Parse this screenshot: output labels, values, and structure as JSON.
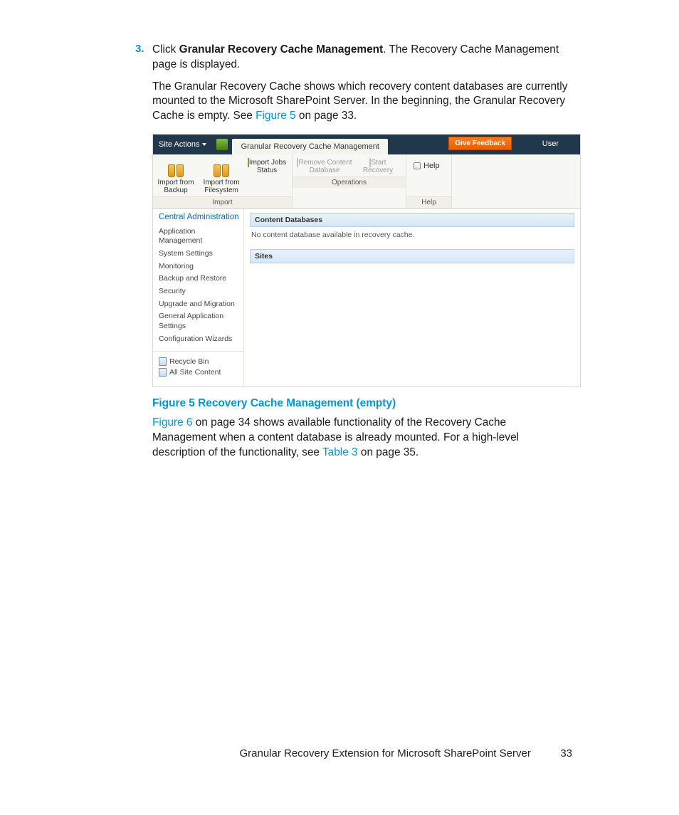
{
  "list": {
    "num": "3."
  },
  "para1": {
    "pre": "Click ",
    "bold": "Granular Recovery Cache Management",
    "post": ". The Recovery Cache Management page is displayed."
  },
  "para2": {
    "pre": "The Granular Recovery Cache shows which recovery content databases are currently mounted to the Microsoft SharePoint Server. In the beginning, the Granular Recovery Cache is empty. See ",
    "link": "Figure 5",
    "post": " on page 33."
  },
  "screenshot": {
    "topbar": {
      "site_actions": "Site Actions",
      "tab": "Granular Recovery Cache Management",
      "feedback": "Give Feedback",
      "user": "User"
    },
    "ribbon": {
      "groups": {
        "import": {
          "label": "Import",
          "btns": [
            {
              "l1": "Import from",
              "l2": "Backup"
            },
            {
              "l1": "Import from",
              "l2": "Filesystem"
            },
            {
              "l1": "Import Jobs",
              "l2": "Status"
            }
          ]
        },
        "operations": {
          "label": "Operations",
          "btns": [
            {
              "l1": "Remove Content",
              "l2": "Database"
            },
            {
              "l1": "Start",
              "l2": "Recovery"
            }
          ]
        },
        "help": {
          "label": "Help",
          "btn": "Help"
        }
      }
    },
    "sidebar": {
      "heading": "Central Administration",
      "items": [
        "Application Management",
        "System Settings",
        "Monitoring",
        "Backup and Restore",
        "Security",
        "Upgrade and Migration",
        "General Application Settings",
        "Configuration Wizards"
      ],
      "extras": [
        "Recycle Bin",
        "All Site Content"
      ]
    },
    "main": {
      "section1_title": "Content Databases",
      "section1_msg": "No content database available in recovery cache.",
      "section2_title": "Sites"
    }
  },
  "figure_caption": "Figure 5 Recovery Cache Management (empty)",
  "para3": {
    "link1": "Figure 6",
    "mid1": " on page 34 shows available functionality of the Recovery Cache Management when a content database is already mounted. For a high-level description of the functionality, see ",
    "link2": "Table 3",
    "post": " on page 35."
  },
  "footer": {
    "title": "Granular Recovery Extension for Microsoft SharePoint Server",
    "page": "33"
  }
}
